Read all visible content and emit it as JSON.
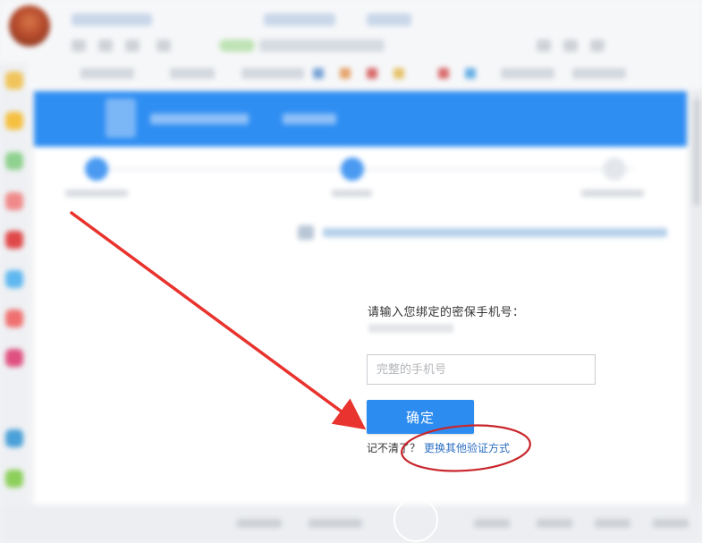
{
  "form": {
    "prompt": "请输入您绑定的密保手机号：",
    "phone_placeholder": "完整的手机号",
    "phone_value": "",
    "confirm_label": "确定",
    "forgot_prefix": "记不清了？",
    "switch_method_link": "更换其他验证方式"
  },
  "annotations": {
    "arrow_color": "#e8332e",
    "circle_color": "#c8262c"
  },
  "colors": {
    "header_blue": "#2f8ef2",
    "button_blue": "#2d8cf0",
    "link_blue": "#2d6fc2"
  }
}
